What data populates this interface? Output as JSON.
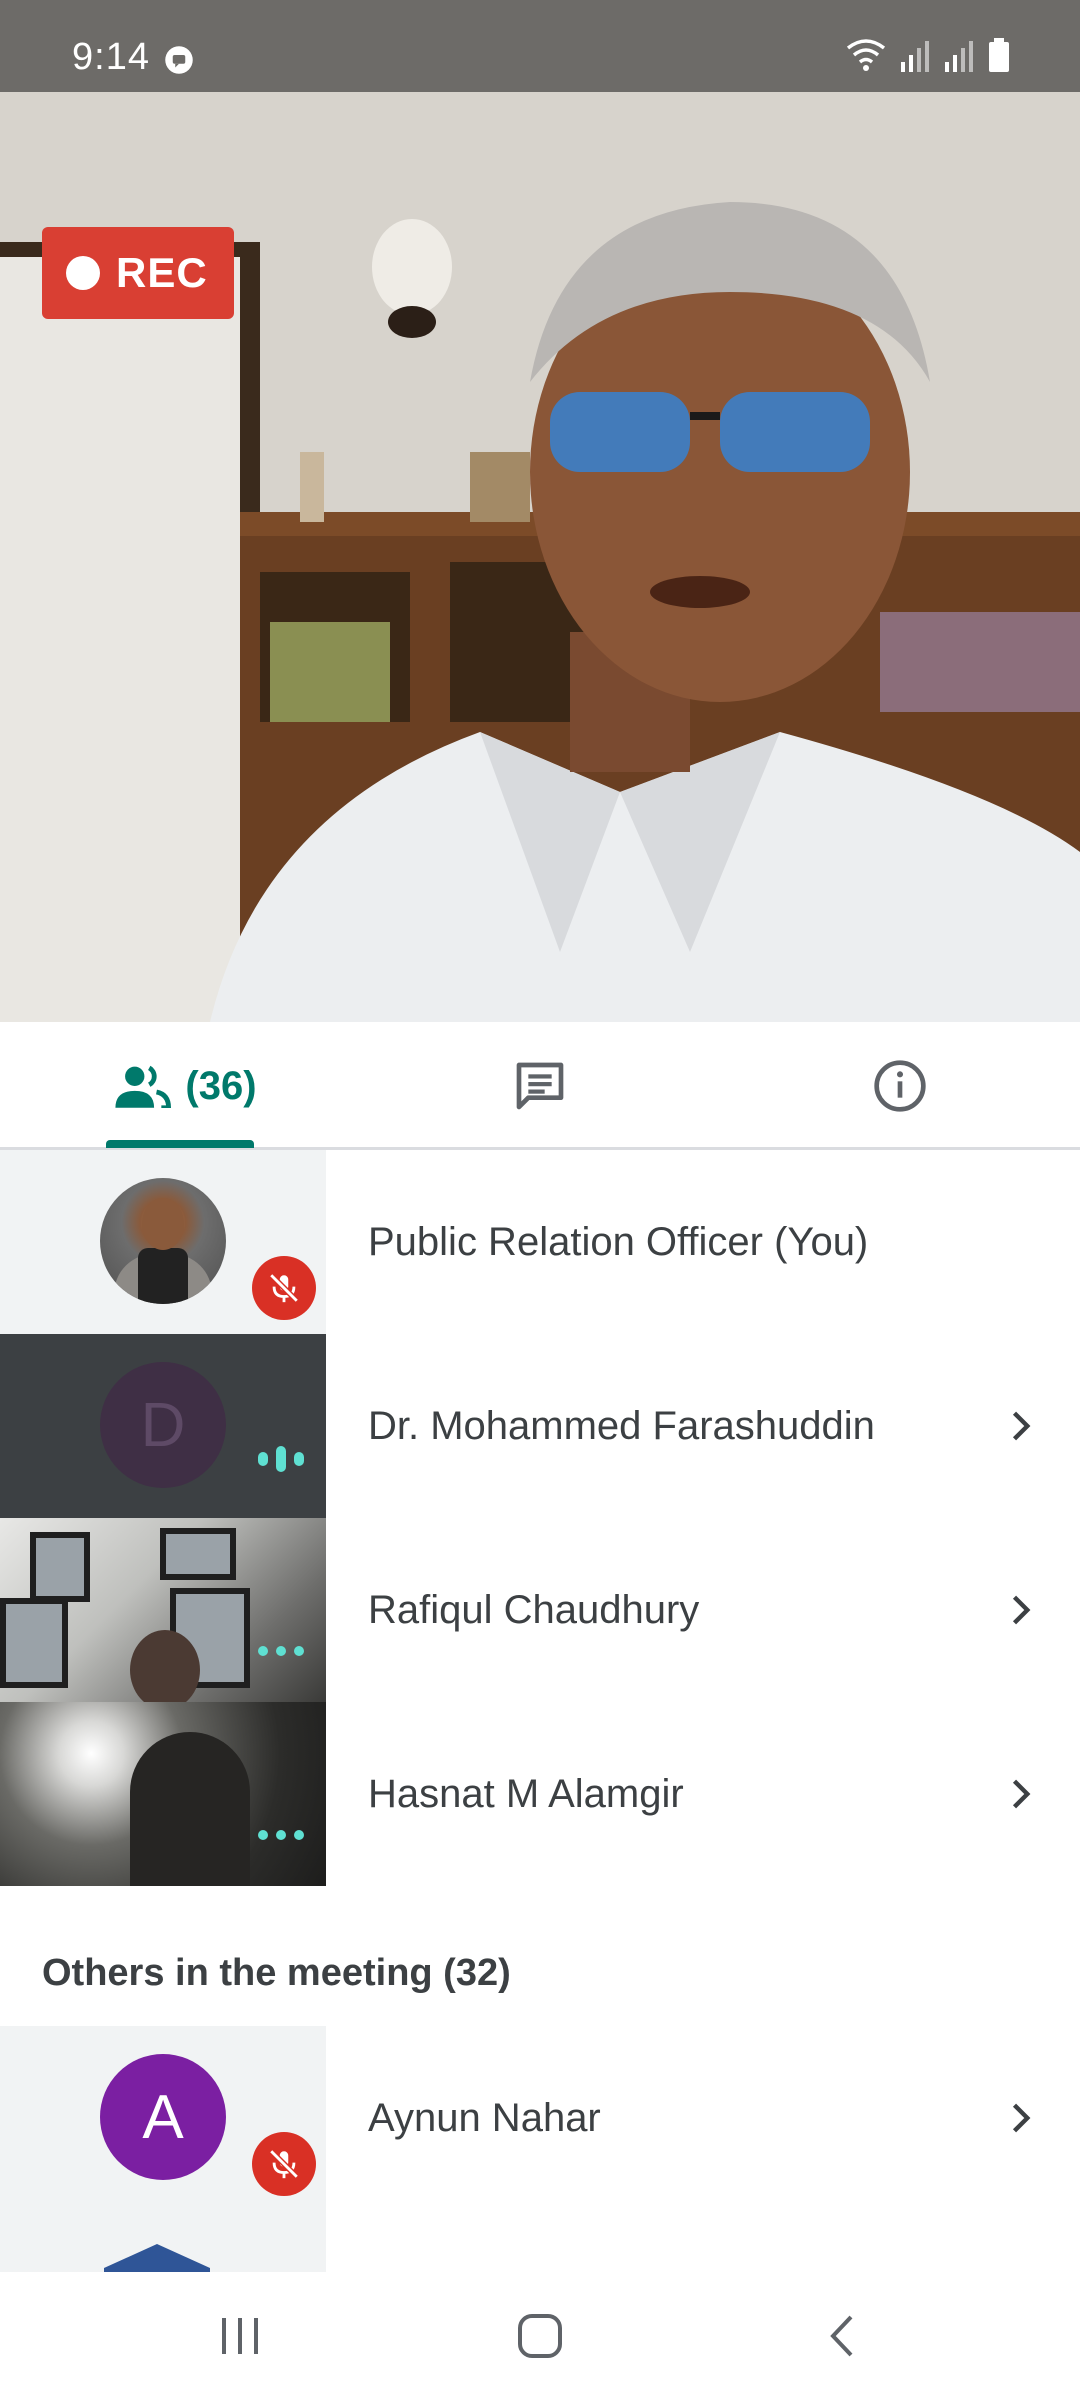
{
  "status_bar": {
    "time": "9:14",
    "icons": [
      "chat-notification-icon",
      "wifi-icon",
      "signal-icon",
      "signal-icon",
      "battery-icon"
    ]
  },
  "video": {
    "recording_label": "REC",
    "recording_color": "#d93f33"
  },
  "tabs": {
    "people_count": "(36)",
    "people_icon": "people-icon",
    "chat_icon": "chat-icon",
    "info_icon": "info-icon",
    "accent": "#00796b"
  },
  "participants": [
    {
      "name": "Public Relation Officer (You)",
      "status": "muted"
    },
    {
      "name": "Dr. Mohammed Farashuddin",
      "avatar_letter": "D",
      "status": "speaking"
    },
    {
      "name": "Rafiqul Chaudhury",
      "status": "audio-dots"
    },
    {
      "name": "Hasnat M Alamgir",
      "status": "audio-dots"
    }
  ],
  "others": {
    "header": "Others in the meeting (32)",
    "items": [
      {
        "name": "Aynun Nahar",
        "avatar_letter": "A",
        "status": "muted"
      }
    ]
  },
  "colors": {
    "mute_badge": "#d93025",
    "audio_indicator": "#5fe0d2",
    "avatar_a": "#7b1fa2"
  }
}
